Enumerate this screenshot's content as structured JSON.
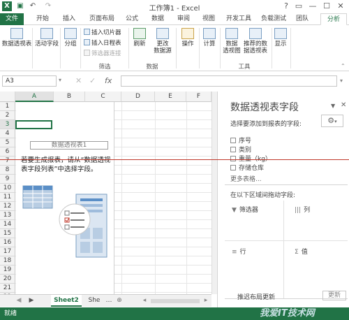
{
  "window": {
    "title": "工作簿1 - Excel",
    "help": "?",
    "restore": "▭",
    "minimize": "—",
    "maximize": "☐",
    "close": "✕"
  },
  "quick_access": {
    "excel": "X",
    "save": "▣",
    "undo": "↶",
    "redo": "↷"
  },
  "tabs": [
    "文件",
    "开始",
    "插入",
    "页面布局",
    "公式",
    "数据",
    "审阅",
    "视图",
    "开发工具",
    "负载测试",
    "团队",
    "分析"
  ],
  "ribbon": {
    "pivot_table": "数据透视表",
    "active_field": "活动字段",
    "group": "分组",
    "insert_slicer": "插入切片器",
    "insert_timeline": "插入日程表",
    "filter_connections": "筛选器连接",
    "filter_group": "筛选",
    "refresh": "刷新",
    "change_source_1": "更改",
    "change_source_2": "数据源",
    "data_group": "数据",
    "actions": "操作",
    "calculations": "计算",
    "pivot_chart_1": "数据",
    "pivot_chart_2": "透视图",
    "recommended_1": "推荐的数",
    "recommended_2": "据透视表",
    "tools_group": "工具",
    "show": "显示"
  },
  "formula_bar": {
    "name_box": "A3",
    "cancel": "✕",
    "enter": "✓",
    "fx": "fx"
  },
  "columns": [
    "A",
    "B",
    "C",
    "D",
    "E",
    "F"
  ],
  "rows": [
    "1",
    "2",
    "3",
    "4",
    "5",
    "6",
    "7",
    "8",
    "9",
    "10",
    "11",
    "12",
    "13",
    "14",
    "15",
    "16",
    "17",
    "18",
    "19",
    "20",
    "21",
    "22"
  ],
  "pivot_placeholder": {
    "name": "数据透视表1",
    "hint": "若要生成报表，请从“数据透视表字段列表”中选择字段。"
  },
  "sheets": {
    "prev": "◀",
    "next": "▶",
    "active": "Sheet2",
    "other": "She",
    "add": "⊕",
    "more": "…"
  },
  "status": {
    "ready": "就绪"
  },
  "pane": {
    "title": "数据透视表字段",
    "subtitle": "选择要添加到报表的字段:",
    "close": "✕",
    "dropdown": "▼",
    "options": "⚙",
    "fields": [
      "序号",
      "类别",
      "重量（kg）",
      "存储仓库",
      "更多表格..."
    ],
    "drag_hint": "在以下区域间拖动字段:",
    "areas": {
      "filters": "筛选器",
      "columns": "列",
      "rows": "行",
      "values": "值"
    },
    "defer": "推迟布局更新",
    "update": "更新"
  },
  "watermark": "我爱IT技术网"
}
